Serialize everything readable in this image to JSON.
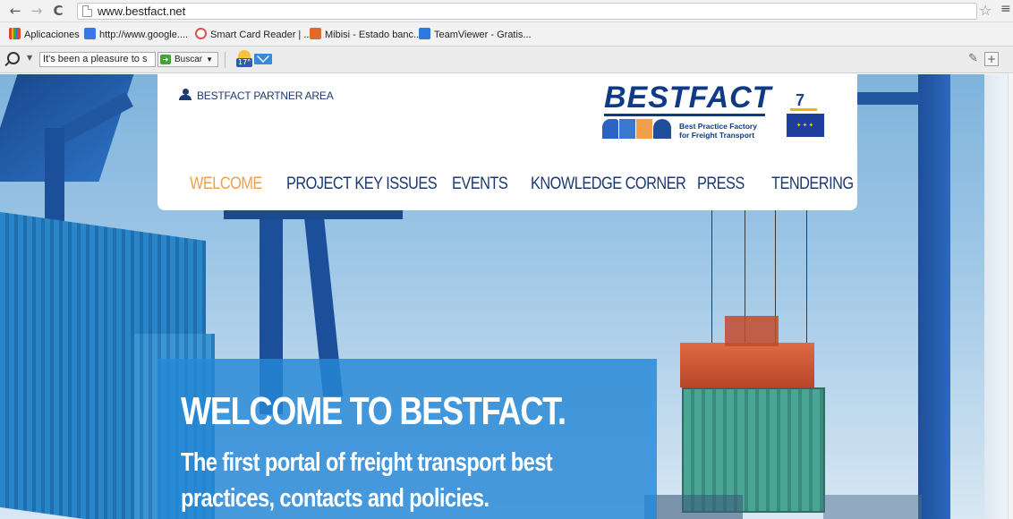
{
  "browser": {
    "url": "www.bestfact.net",
    "bookmarks": [
      {
        "label": "Aplicaciones",
        "color": "#e0452e"
      },
      {
        "label": "http://www.google....",
        "color": "#3b78e7"
      },
      {
        "label": "Smart Card Reader | ...",
        "color": "#e05050"
      },
      {
        "label": "Mibisi - Estado banc...",
        "color": "#e06a2a"
      },
      {
        "label": "TeamViewer - Gratis...",
        "color": "#2a7ae0"
      }
    ],
    "toolbar": {
      "search_value": "It's been a pleasure to s",
      "search_button": "Buscar",
      "weather_badge": "17°"
    }
  },
  "site": {
    "partner_area": "BESTFACT PARTNER AREA",
    "logo": {
      "word": "BESTFACT",
      "subtitle_line1": "Best Practice Factory",
      "subtitle_line2": "for Freight Transport"
    },
    "eu_logo": {
      "digit": "7"
    },
    "nav": [
      {
        "label": "WELCOME",
        "active": true
      },
      {
        "label": "PROJECT KEY ISSUES",
        "active": false
      },
      {
        "label": "EVENTS",
        "active": false
      },
      {
        "label": "KNOWLEDGE CORNER",
        "active": false
      },
      {
        "label": "PRESS",
        "active": false
      },
      {
        "label": "TENDERING",
        "active": false
      }
    ],
    "hero": {
      "title": "WELCOME TO BESTFACT.",
      "subtitle": "The first portal of freight transport best practices, contacts and policies."
    }
  },
  "colors": {
    "brand_navy": "#1b3a73",
    "nav_active": "#f0a04b",
    "hero_overlay": "#2687d6"
  }
}
